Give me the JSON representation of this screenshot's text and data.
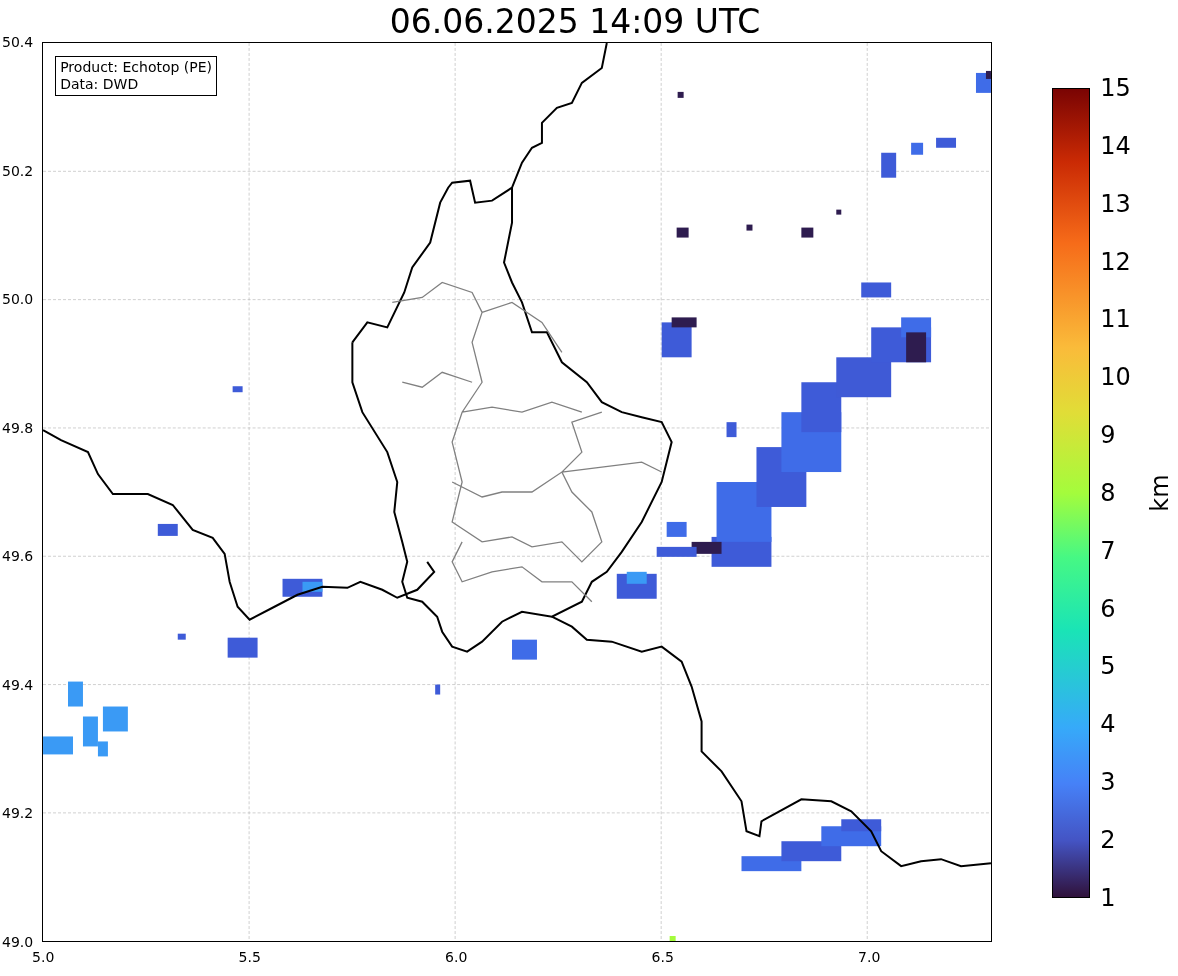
{
  "title": "06.06.2025 14:09 UTC",
  "info": [
    "Product: Echotop (PE)",
    "Data: DWD"
  ],
  "y_ticks": [
    "50.4",
    "50.2",
    "50.0",
    "49.8",
    "49.6",
    "49.4",
    "49.2",
    "49.0"
  ],
  "x_ticks": [
    "5.0",
    "5.5",
    "6.0",
    "6.5",
    "7.0"
  ],
  "colorbar": {
    "label": "km",
    "ticks": [
      "15",
      "14",
      "13",
      "12",
      "11",
      "10",
      "9",
      "8",
      "7",
      "6",
      "5",
      "4",
      "3",
      "2",
      "1"
    ]
  }
}
